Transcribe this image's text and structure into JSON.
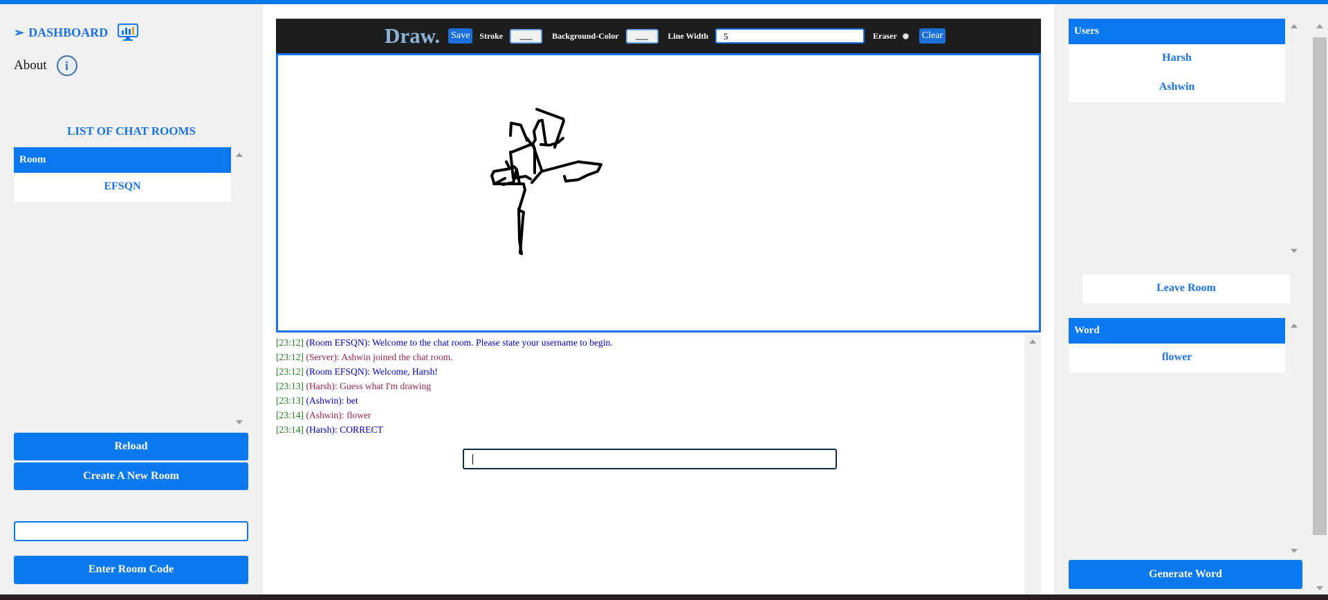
{
  "left": {
    "dashboard_label": "DASHBOARD",
    "dashboard_arrow": "➢",
    "about_label": "About",
    "rooms_title": "LIST OF CHAT ROOMS",
    "rooms_header": "Room",
    "rooms": [
      "EFSQN"
    ],
    "reload_label": "Reload",
    "create_label": "Create A New Room",
    "room_code_value": "",
    "enter_code_label": "Enter Room Code"
  },
  "toolbar": {
    "title": "Draw.",
    "save_label": "Save",
    "stroke_label": "Stroke",
    "stroke_swatch": "___",
    "bg_color_label": "Background-Color",
    "bg_swatch": "___",
    "line_width_label": "Line Width",
    "line_width_value": "5",
    "eraser_label": "Eraser",
    "clear_label": "Clear"
  },
  "chat": {
    "messages": [
      {
        "time": "[23:12]",
        "sender": "(Room EFSQN):",
        "text": "Welcome to the chat room. Please state your username to begin.",
        "color": "blue"
      },
      {
        "time": "[23:12]",
        "sender": "(Server):",
        "text": "Ashwin joined the chat room.",
        "color": "red"
      },
      {
        "time": "[23:12]",
        "sender": "(Room EFSQN):",
        "text": "Welcome, Harsh!",
        "color": "blue"
      },
      {
        "time": "[23:13]",
        "sender": "(Harsh):",
        "text": "Guess what I'm drawing",
        "color": "red"
      },
      {
        "time": "[23:13]",
        "sender": "(Ashwin):",
        "text": "bet",
        "color": "blue"
      },
      {
        "time": "[23:14]",
        "sender": "(Ashwin):",
        "text": "flower",
        "color": "red"
      },
      {
        "time": "[23:14]",
        "sender": "(Harsh):",
        "text": "CORRECT",
        "color": "blue"
      }
    ],
    "input_value": ""
  },
  "right": {
    "users_header": "Users",
    "users": [
      "Harsh",
      "Ashwin"
    ],
    "leave_label": "Leave Room",
    "word_header": "Word",
    "word": "flower",
    "generate_label": "Generate Word"
  },
  "colors": {
    "accent": "#0a78ef",
    "toolbar_bg": "#1e1e1e",
    "panel_bg": "#f0f0f0"
  }
}
